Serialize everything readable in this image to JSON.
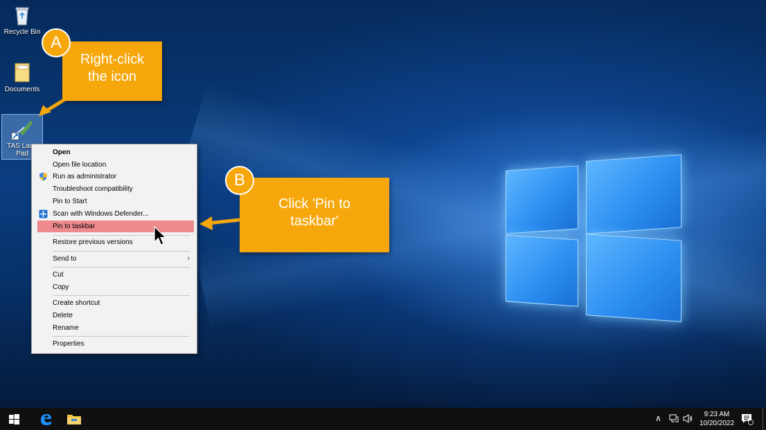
{
  "desktop": {
    "icons": [
      {
        "label": "Recycle Bin",
        "icon": "recycle-bin-icon"
      },
      {
        "label": "Documents",
        "icon": "folder-icon"
      },
      {
        "label": "TAS Laun\nPad",
        "label_line1": "TAS Laun",
        "label_line2": "Pad",
        "icon": "tas-launchpad-icon"
      }
    ]
  },
  "context_menu": {
    "items": [
      {
        "label": "Open",
        "bold": true
      },
      {
        "label": "Open file location"
      },
      {
        "label": "Run as administrator",
        "icon": "uac-shield-icon"
      },
      {
        "label": "Troubleshoot compatibility"
      },
      {
        "label": "Pin to Start"
      },
      {
        "label": "Scan with Windows Defender...",
        "icon": "defender-icon"
      },
      {
        "label": "Pin to taskbar",
        "highlighted": true
      },
      {
        "label": "Restore previous versions"
      },
      {
        "label": "Send to",
        "submenu": true
      },
      {
        "label": "Cut"
      },
      {
        "label": "Copy"
      },
      {
        "label": "Create shortcut"
      },
      {
        "label": "Delete"
      },
      {
        "label": "Rename"
      },
      {
        "label": "Properties"
      }
    ]
  },
  "callouts": {
    "a": {
      "badge": "A",
      "line1": "Right-click",
      "line2": "the icon"
    },
    "b": {
      "badge": "B",
      "line1": "Click 'Pin to",
      "line2": "taskbar'"
    }
  },
  "taskbar": {
    "time": "9:23 AM",
    "date": "10/20/2022",
    "pinned": [
      "windows-start-icon",
      "edge-icon",
      "file-explorer-icon"
    ]
  },
  "colors": {
    "callout": "#f6a70b",
    "highlight": "#ee8a8e",
    "taskbar": "#101010"
  }
}
